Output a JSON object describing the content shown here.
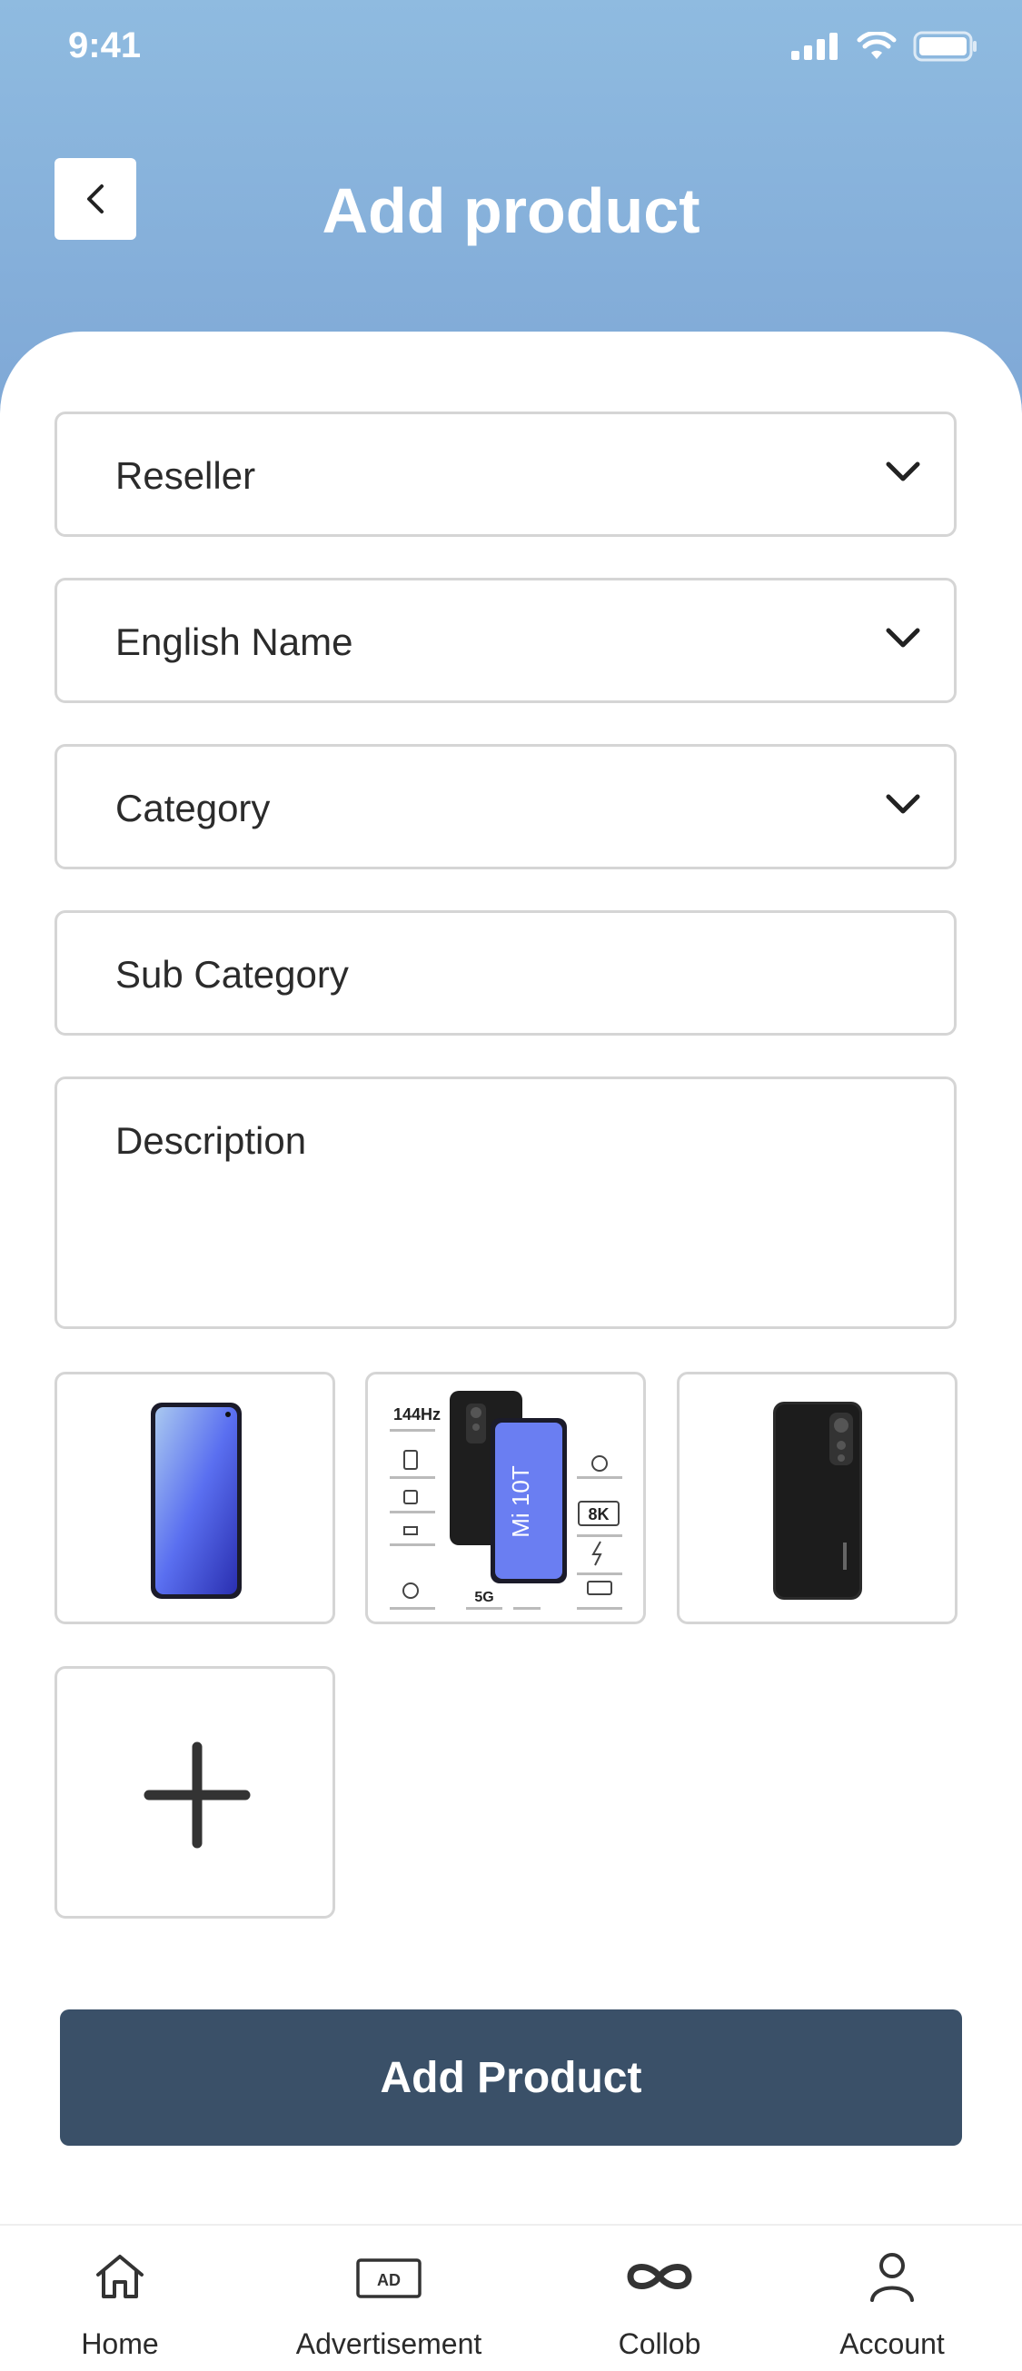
{
  "status": {
    "time": "9:41"
  },
  "header": {
    "title": "Add product"
  },
  "form": {
    "reseller": "Reseller",
    "english_name": "English Name",
    "category": "Category",
    "sub_category": "Sub Category",
    "description": "Description"
  },
  "images": [
    {
      "name": "phone-front-image"
    },
    {
      "name": "phone-box-image",
      "model": "Mi 10T",
      "specs": [
        "144Hz",
        "8K",
        "5G"
      ]
    },
    {
      "name": "phone-back-image"
    }
  ],
  "actions": {
    "add_product": "Add Product"
  },
  "tabbar": {
    "home": "Home",
    "advertisement": "Advertisement",
    "ad_badge": "AD",
    "collob": "Collob",
    "account": "Account"
  },
  "colors": {
    "header": "#8fbbe0",
    "button": "#3a5068",
    "border": "#d5d5d5"
  },
  "icons": [
    "signal-icon",
    "wifi-icon",
    "battery-icon",
    "back-arrow-icon",
    "chevron-down-icon",
    "plus-icon",
    "home-icon",
    "ad-icon",
    "infinity-icon",
    "user-icon"
  ]
}
